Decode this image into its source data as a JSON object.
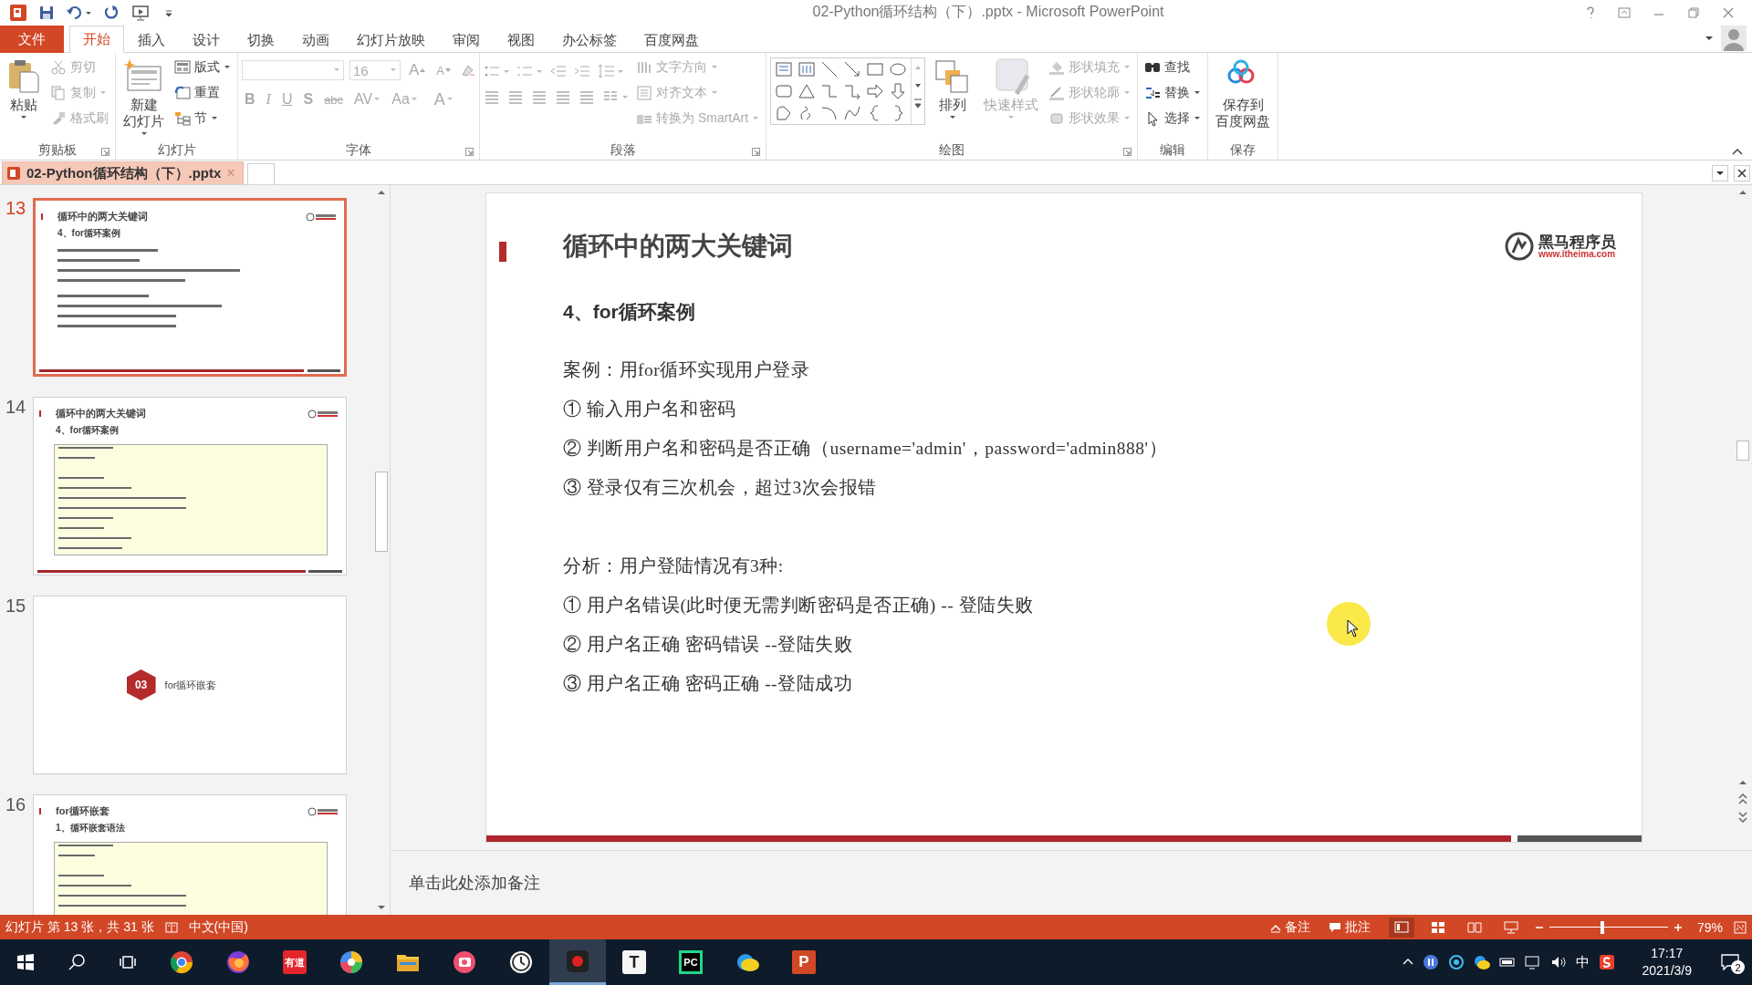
{
  "title_bar": {
    "title": "02-Python循环结构（下）.pptx - Microsoft PowerPoint"
  },
  "ribbon_tabs": [
    {
      "label": "文件",
      "kind": "file",
      "selected": false
    },
    {
      "label": "开始",
      "kind": "tab",
      "selected": true
    },
    {
      "label": "插入",
      "kind": "tab",
      "selected": false
    },
    {
      "label": "设计",
      "kind": "tab",
      "selected": false
    },
    {
      "label": "切换",
      "kind": "tab",
      "selected": false
    },
    {
      "label": "动画",
      "kind": "tab",
      "selected": false
    },
    {
      "label": "幻灯片放映",
      "kind": "tab",
      "selected": false
    },
    {
      "label": "审阅",
      "kind": "tab",
      "selected": false
    },
    {
      "label": "视图",
      "kind": "tab",
      "selected": false
    },
    {
      "label": "办公标签",
      "kind": "tab",
      "selected": false
    },
    {
      "label": "百度网盘",
      "kind": "tab",
      "selected": false
    }
  ],
  "ribbon_groups": [
    {
      "label": "剪贴板",
      "kind": "buttons",
      "launcher": true,
      "items": [
        {
          "lines": [
            "粘贴"
          ],
          "kind": "large",
          "disabled": false,
          "dropdown": true
        },
        {
          "lines": [
            "剪切"
          ],
          "kind": "small",
          "disabled": true,
          "dropdown": false
        },
        {
          "lines": [
            "复制"
          ],
          "kind": "small",
          "disabled": true,
          "dropdown": true
        },
        {
          "lines": [
            "格式刷"
          ],
          "kind": "small",
          "disabled": true,
          "dropdown": false
        }
      ]
    },
    {
      "label": "幻灯片",
      "kind": "buttons",
      "items": [
        {
          "lines": [
            "新建",
            "幻灯片"
          ],
          "kind": "large",
          "disabled": false,
          "dropdown": true
        },
        {
          "lines": [
            "版式"
          ],
          "kind": "small",
          "disabled": false,
          "dropdown": true
        },
        {
          "lines": [
            "重置"
          ],
          "kind": "small",
          "disabled": false,
          "dropdown": false
        },
        {
          "lines": [
            "节"
          ],
          "kind": "small",
          "disabled": false,
          "dropdown": true
        }
      ]
    },
    {
      "label": "字体",
      "kind": "font",
      "launcher": true,
      "font_size": "16",
      "size_buttons": [
        "A",
        "A"
      ],
      "format_buttons": [
        "B",
        "I",
        "U",
        "S",
        "abc",
        "AV",
        "Aa"
      ],
      "color_button": "A"
    },
    {
      "label": "段落",
      "kind": "paragraph",
      "launcher": true,
      "items": [
        {
          "lines": [
            "文字方向"
          ],
          "kind": "small",
          "disabled": true,
          "dropdown": true
        },
        {
          "lines": [
            "对齐文本"
          ],
          "kind": "small",
          "disabled": true,
          "dropdown": true
        },
        {
          "lines": [
            "转换为 SmartArt"
          ],
          "kind": "small",
          "disabled": true,
          "dropdown": true
        }
      ]
    },
    {
      "label": "绘图",
      "kind": "drawing",
      "launcher": true,
      "items": [
        {
          "lines": [
            "排列"
          ],
          "kind": "large",
          "disabled": false,
          "dropdown": true
        },
        {
          "lines": [
            "快速样式"
          ],
          "kind": "large",
          "disabled": true,
          "dropdown": true
        },
        {
          "lines": [
            "形状填充"
          ],
          "kind": "small",
          "disabled": true,
          "dropdown": true
        },
        {
          "lines": [
            "形状轮廓"
          ],
          "kind": "small",
          "disabled": true,
          "dropdown": true
        },
        {
          "lines": [
            "形状效果"
          ],
          "kind": "small",
          "disabled": true,
          "dropdown": true
        }
      ]
    },
    {
      "label": "编辑",
      "kind": "buttons",
      "items": [
        {
          "lines": [
            "查找"
          ],
          "kind": "small",
          "disabled": false,
          "dropdown": false
        },
        {
          "lines": [
            "替换"
          ],
          "kind": "small",
          "disabled": false,
          "dropdown": true
        },
        {
          "lines": [
            "选择"
          ],
          "kind": "small",
          "disabled": false,
          "dropdown": true
        }
      ]
    },
    {
      "label": "保存",
      "kind": "buttons",
      "items": [
        {
          "lines": [
            "保存到",
            "百度网盘"
          ],
          "kind": "large",
          "disabled": false,
          "dropdown": false
        }
      ]
    }
  ],
  "document_tab": {
    "label": "02-Python循环结构（下）.pptx",
    "close": "×",
    "selected": true
  },
  "thumbnails": [
    {
      "number": "13",
      "kind": "content",
      "selected": true,
      "title": "循环中的两大关键词",
      "heading": "4、for循环案例"
    },
    {
      "number": "14",
      "kind": "code",
      "selected": false,
      "title": "循环中的两大关键词",
      "heading": "4、for循环案例"
    },
    {
      "number": "15",
      "kind": "section",
      "selected": false,
      "badge": "03",
      "title": "for循环嵌套"
    },
    {
      "number": "16",
      "kind": "code",
      "selected": false,
      "title": "for循环嵌套",
      "heading": "1、循环嵌套语法"
    }
  ],
  "slide": {
    "title": "循环中的两大关键词",
    "logo": {
      "name": "黑马程序员",
      "url": "www.itheima.com"
    },
    "heading": "4、for循环案例",
    "paragraph_groups": [
      [
        "案例：用for循环实现用户登录",
        "① 输入用户名和密码",
        "② 判断用户名和密码是否正确（username='admin'，password='admin888'）",
        "③ 登录仅有三次机会，超过3次会报错"
      ],
      [
        "分析：用户登陆情况有3种:",
        "① 用户名错误(此时便无需判断密码是否正确) -- 登陆失败",
        "② 用户名正确 密码错误 --登陆失败",
        "③ 用户名正确 密码正确 --登陆成功"
      ]
    ]
  },
  "notes": {
    "placeholder": "单击此处添加备注"
  },
  "status_bar": {
    "slide_info": "幻灯片 第 13 张，共 31 张",
    "language": "中文(中国)",
    "notes_button": "备注",
    "comments_button": "批注",
    "zoom": "79%",
    "zoom_slider": {
      "level": 0.45
    },
    "views": [
      {
        "kind": "normal",
        "selected": true
      },
      {
        "kind": "sorter",
        "selected": false
      },
      {
        "kind": "reading",
        "selected": false
      },
      {
        "kind": "show",
        "selected": false
      }
    ]
  },
  "taskbar": {
    "apps": [
      {
        "kind": "chrome",
        "selected": false
      },
      {
        "kind": "firefox",
        "selected": false
      },
      {
        "kind": "youdao",
        "label": "有道",
        "selected": false
      },
      {
        "kind": "colorball",
        "selected": false
      },
      {
        "kind": "folder",
        "selected": false
      },
      {
        "kind": "redapp",
        "selected": false
      },
      {
        "kind": "clock",
        "selected": false
      },
      {
        "kind": "record",
        "selected": true
      },
      {
        "kind": "letter",
        "label": "T",
        "selected": false
      },
      {
        "kind": "pycharm",
        "label": "PC",
        "selected": false
      },
      {
        "kind": "cloud",
        "selected": false
      },
      {
        "kind": "ppt",
        "label": "P",
        "selected": false
      }
    ],
    "ime": "中",
    "time": "17:17",
    "date": "2021/3/9",
    "notifications": "2"
  }
}
